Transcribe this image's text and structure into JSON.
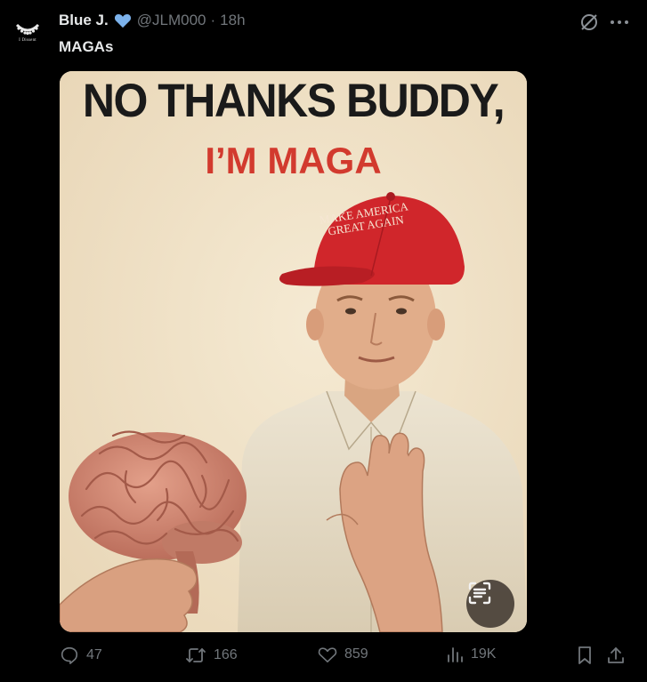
{
  "post": {
    "display_name": "Blue J.",
    "handle": "@JLM000",
    "separator": "·",
    "time": "18h",
    "text": "MAGAs",
    "avatar_label": "I Dissent",
    "verified_color": "#7cb2ec"
  },
  "image": {
    "headline_line1": "NO THANKS BUDDY,",
    "headline_line2": "I’M MAGA",
    "cap_line1": "MAKE AMERICA",
    "cap_line2": "GREAT AGAIN",
    "headline_color": "#d23a2e",
    "cap_color": "#d0262b"
  },
  "icons": {
    "grok": "grok-icon",
    "more": "more-icon",
    "lens": "lens-icon"
  },
  "actions": {
    "replies": "47",
    "reposts": "166",
    "likes": "859",
    "views": "19K"
  }
}
